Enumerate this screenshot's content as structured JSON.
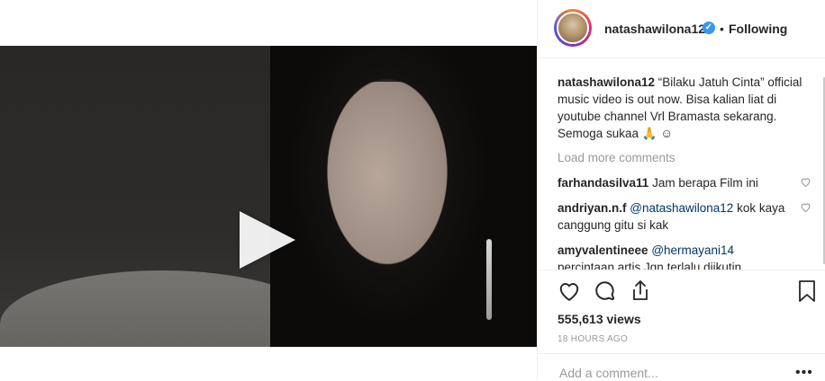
{
  "header": {
    "username": "natashawilona12",
    "verified_mark": "✓",
    "separator": "•",
    "follow_status": "Following"
  },
  "caption": {
    "user": "natashawilona12",
    "text": " “Bilaku Jatuh Cinta” official music video is out now. Bisa kalian liat di youtube channel Vrl Bramasta sekarang. Semoga sukaa 🙏 ☺"
  },
  "load_more": "Load more comments",
  "comments": [
    {
      "user": "farhandasilva11",
      "text": " Jam berapa Film ini",
      "mention": ""
    },
    {
      "user": "andriyan.n.f",
      "mention": " @natashawilona12",
      "text": " kok kaya canggung gitu si kak"
    },
    {
      "user": "amyvalentineee",
      "mention": " @hermayani14",
      "text": " percintaan artis Jgn terlalu diikutin ,"
    }
  ],
  "stats": {
    "views": "555,613 views",
    "time": "18 HOURS AGO"
  },
  "add_comment": {
    "placeholder": "Add a comment...",
    "more": "•••"
  },
  "icons": {
    "play": "play-icon",
    "tag": "user-tag-icon",
    "like": "heart-icon",
    "comment": "comment-bubble-icon",
    "share": "share-icon",
    "save": "bookmark-icon"
  },
  "colors": {
    "mention": "#003569",
    "verified": "#3897f0",
    "muted": "#999999"
  }
}
